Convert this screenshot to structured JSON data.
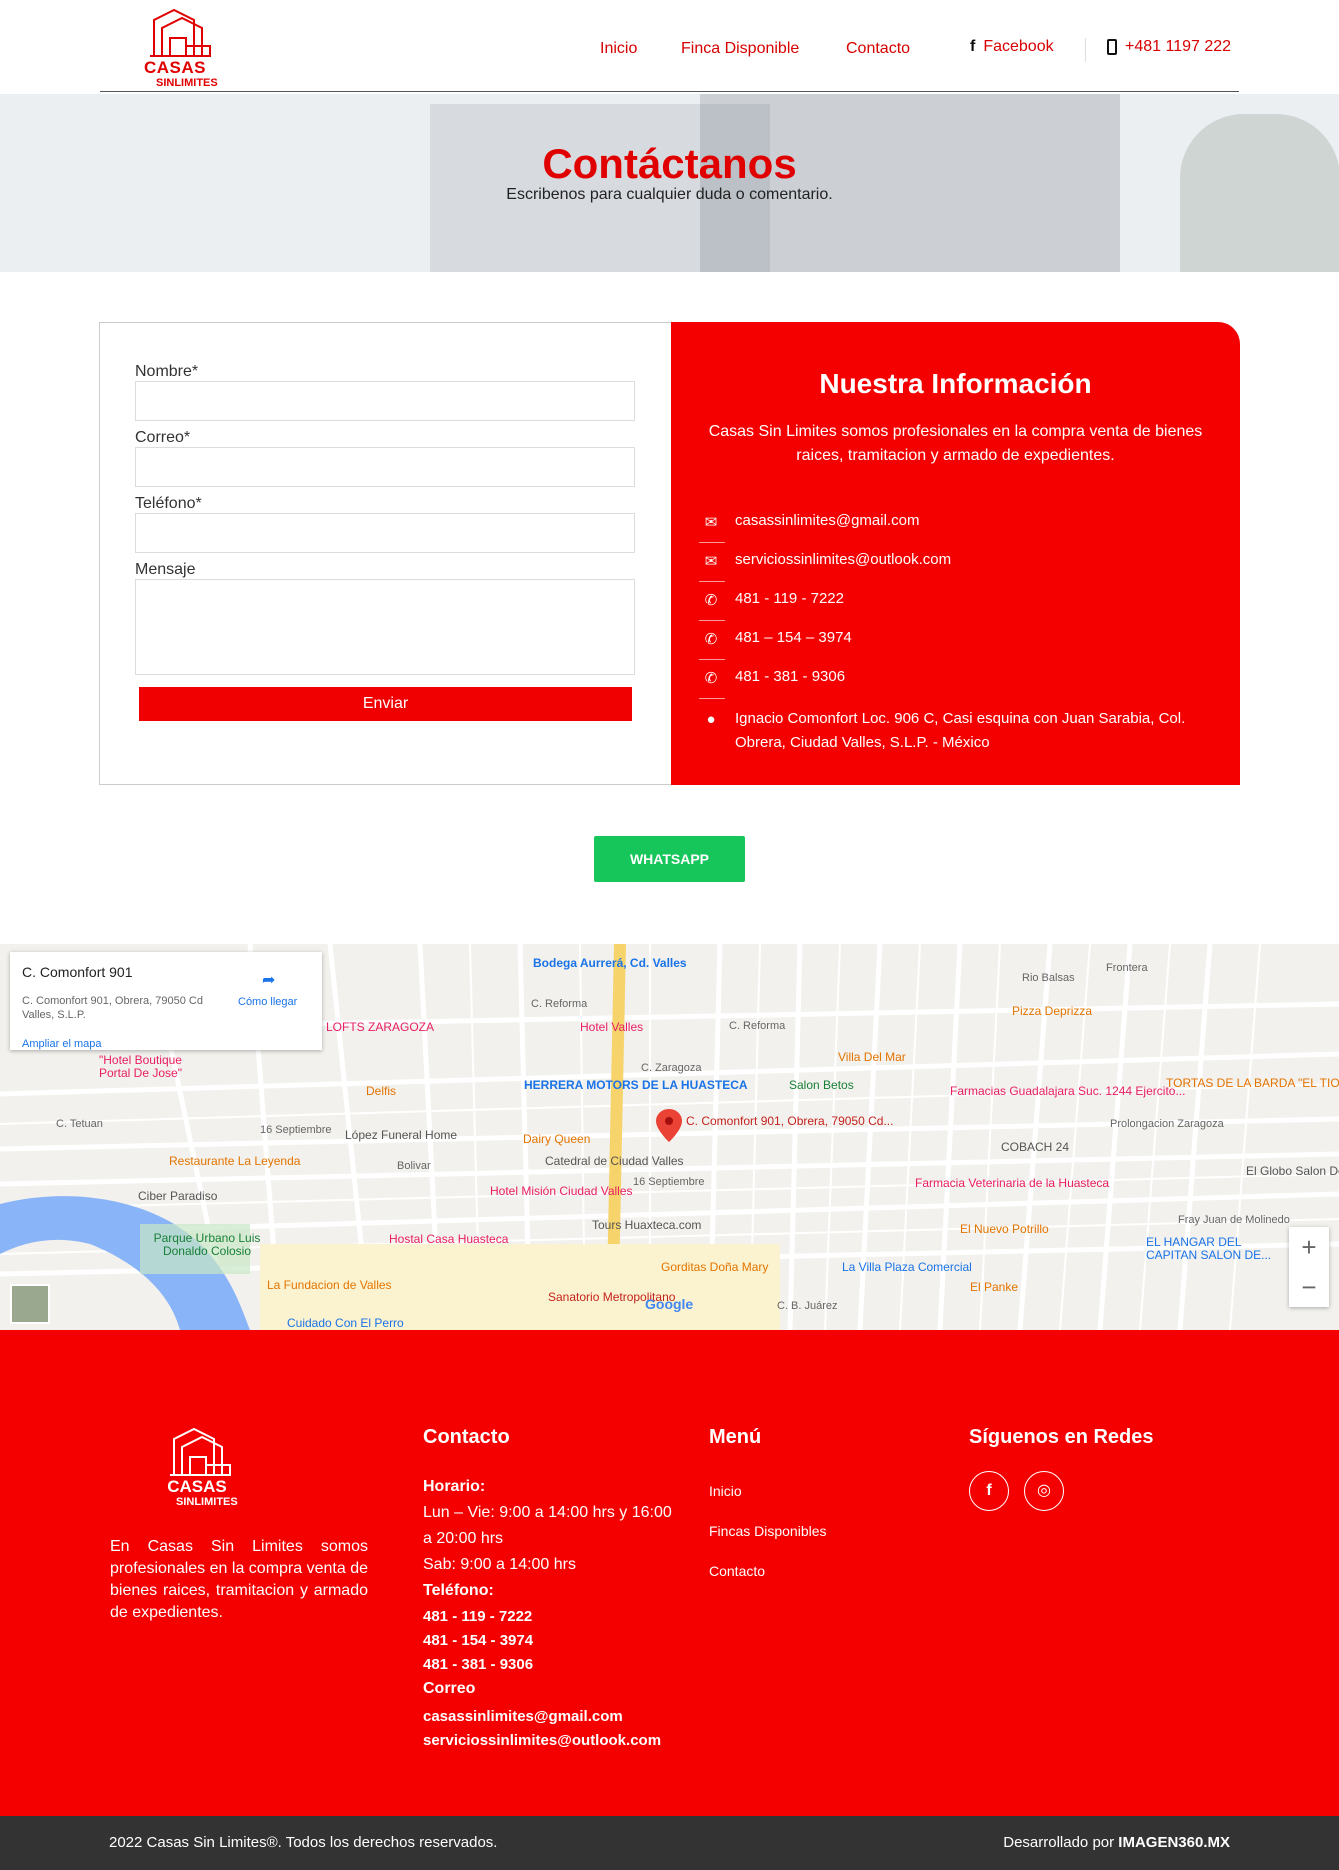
{
  "brand": {
    "line1": "CASAS",
    "line2": "SINLIMITES",
    "color": "#e00000"
  },
  "nav": {
    "items": [
      "Inicio",
      "Finca Disponible",
      "Contacto"
    ],
    "facebook": "Facebook",
    "phone": "+481 1197 222"
  },
  "hero": {
    "title": "Contáctanos",
    "subtitle": "Escribenos para cualquier duda o comentario."
  },
  "form": {
    "name_label": "Nombre*",
    "email_label": "Correo*",
    "phone_label": "Teléfono*",
    "message_label": "Mensaje",
    "submit_label": "Enviar"
  },
  "info": {
    "title": "Nuestra Información",
    "description": "Casas Sin Limites somos profesionales en la compra venta de bienes raices, tramitacion y armado de expedientes.",
    "email1": "casassinlimites@gmail.com",
    "email2": "serviciossinlimites@outlook.com",
    "phone1": "481 - 119 - 7222",
    "phone2": "481 – 154 – 3974",
    "phone3": "481 - 381 - 9306",
    "address": "Ignacio Comonfort Loc. 906 C, Casi esquina con Juan Sarabia, Col. Obrera, Ciudad Valles, S.L.P. - México"
  },
  "whatsapp_label": "WHATSAPP",
  "map": {
    "place_title": "C. Comonfort 901",
    "place_address": "C. Comonfort 901, Obrera, 79050 Cd Valles, S.L.P.",
    "directions": "Cómo llegar",
    "enlarge": "Ampliar el mapa",
    "pin_label": "C. Comonfort 901, Obrera, 79050 Cd...",
    "zoom_in": "+",
    "zoom_out": "−",
    "google": "Google",
    "labels": {
      "bodega": "Bodega Aurrerá, Cd. Valles",
      "lofts": "LOFTS ZARAGOZA",
      "hotel_valles": "Hotel Valles",
      "herrera": "HERRERA MOTORS DE LA HUASTECA",
      "salon_betos": "Salon Betos",
      "pizza": "Pizza Deprizza",
      "del_mar": "Villa Del Mar",
      "farmacias": "Farmacias Guadalajara Suc. 1244 Ejercito...",
      "tortas": "TORTAS DE LA BARDA \"EL TIO LALO\"",
      "cobach": "COBACH 24",
      "globo": "El Globo Salon De Eventos",
      "delfis": "Delfis",
      "funeral": "López Funeral Home",
      "dairy": "Dairy Queen",
      "catedral": "Catedral de Ciudad Valles",
      "leyenda": "Restaurante La Leyenda",
      "ciber": "Ciber Paradiso",
      "mision": "Hotel Misión Ciudad Valles",
      "tours": "Tours Huaxteca.com",
      "veterinaria": "Farmacia Veterinaria de la Huasteca",
      "potrillo": "El Nuevo Potrillo",
      "parque": "Parque Urbano Luis Donaldo Colosio",
      "casa_huasteca": "Hostal Casa Huasteca",
      "gorditas": "Gorditas Doña Mary",
      "plaza": "La Villa Plaza Comercial",
      "panke": "El Panke",
      "fundacion": "La Fundacion de Valles",
      "sanatorio": "Sanatorio Metropolitano",
      "hangar": "EL HANGAR DEL CAPITAN SALON DE...",
      "boutique": "\"Hotel Boutique Portal De Jose\"",
      "perro": "Cuidado Con El Perro",
      "reforma1": "C. Reforma",
      "reforma2": "C. Reforma",
      "zaragoza": "C. Zaragoza",
      "tetuan": "C. Tetuan",
      "septiembre1": "16 Septiembre",
      "septiembre2": "16 Septiembre",
      "bolivar": "Bolivar",
      "frontera": "Frontera",
      "rio_balsas": "Rio Balsas",
      "prolongacion": "Prolongacion Zaragoza",
      "fray": "Fray Juan de Molinedo",
      "juarez": "C. B. Juárez"
    }
  },
  "footer": {
    "about": "En Casas Sin Limites somos profesionales en la compra venta de bienes raices, tramitacion y armado de expedientes.",
    "contact_title": "Contacto",
    "hours_label": "Horario:",
    "hours_1": "Lun – Vie: 9:00 a 14:00 hrs y 16:00",
    "hours_2": "a 20:00 hrs",
    "hours_3": "Sab: 9:00 a 14:00 hrs",
    "phone_label": "Teléfono:",
    "phone1": "481 - 119 - 7222",
    "phone2": "481 - 154 - 3974",
    "phone3": "481 - 381 - 9306",
    "email_label": "Correo",
    "email1": "casassinlimites@gmail.com",
    "email2": "serviciossinlimites@outlook.com",
    "menu_title": "Menú",
    "menu": [
      "Inicio",
      "Fincas Disponibles",
      "Contacto"
    ],
    "social_title": "Síguenos en Redes"
  },
  "bottom": {
    "copyright": "2022 Casas Sin Limites®. Todos los derechos reservados.",
    "dev_prefix": "Desarrollado por ",
    "dev_name": "IMAGEN360.MX"
  },
  "colors": {
    "accent": "#f40000",
    "whatsapp": "#16c65a",
    "bottom_bar": "#333333"
  }
}
